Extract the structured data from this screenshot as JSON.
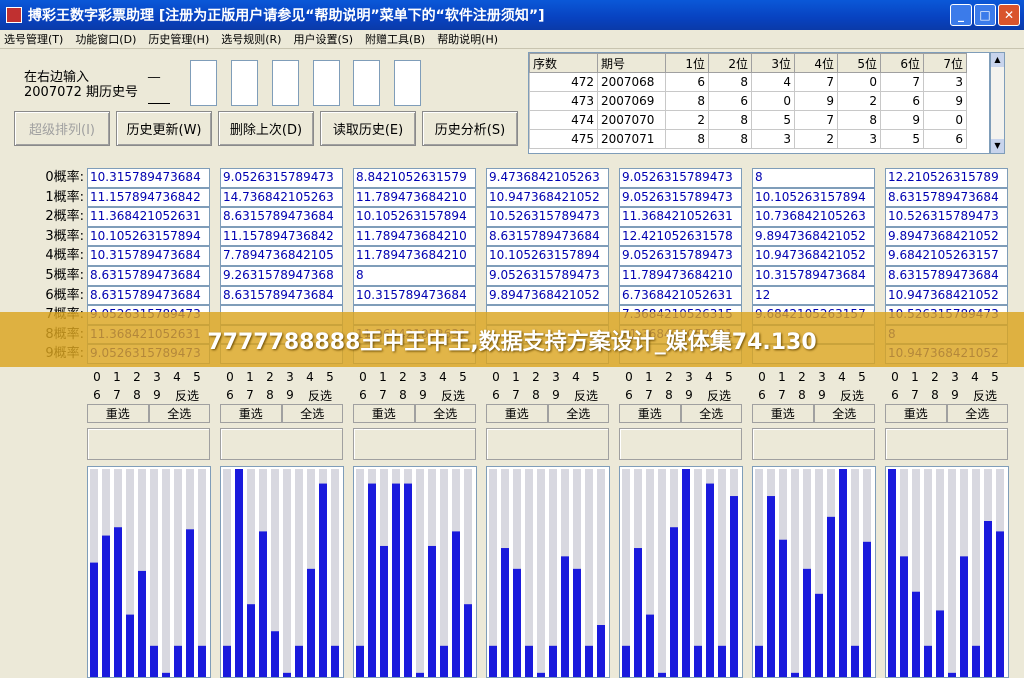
{
  "window": {
    "title": "搏彩王数字彩票助理  [注册为正版用户请参见“帮助说明”菜单下的“软件注册须知”]"
  },
  "menu": [
    "选号管理(T)",
    "功能窗口(D)",
    "历史管理(H)",
    "选号规则(R)",
    "用户设置(S)",
    "附赠工具(B)",
    "帮助说明(H)"
  ],
  "input": {
    "line1": "在右边输入",
    "line2": "2007072 期历史号",
    "placeholder": "__"
  },
  "buttons": {
    "advanced": "超级排列(I)",
    "update": "历史更新(W)",
    "delete": "删除上次(D)",
    "read": "读取历史(E)",
    "analyze": "历史分析(S)"
  },
  "history": {
    "headers": [
      "序数",
      "期号",
      "1位",
      "2位",
      "3位",
      "4位",
      "5位",
      "6位",
      "7位"
    ],
    "rows": [
      [
        "472",
        "2007068",
        "6",
        "8",
        "4",
        "7",
        "0",
        "7",
        "3"
      ],
      [
        "473",
        "2007069",
        "8",
        "6",
        "0",
        "9",
        "2",
        "6",
        "9"
      ],
      [
        "474",
        "2007070",
        "2",
        "8",
        "5",
        "7",
        "8",
        "9",
        "0"
      ],
      [
        "475",
        "2007071",
        "8",
        "8",
        "3",
        "2",
        "3",
        "5",
        "6"
      ]
    ]
  },
  "prob_labels": [
    "0概率:",
    "1概率:",
    "2概率:",
    "3概率:",
    "4概率:",
    "5概率:",
    "6概率:",
    "7概率:",
    "8概率:",
    "9概率:"
  ],
  "prob_cols": [
    [
      "10.315789473684",
      "11.157894736842",
      "11.368421052631",
      "10.105263157894",
      "10.315789473684",
      "8.6315789473684",
      "8.6315789473684",
      "9.0526315789473",
      "11.368421052631",
      "9.0526315789473"
    ],
    [
      "9.0526315789473",
      "14.736842105263",
      "8.6315789473684",
      "11.157894736842",
      "7.7894736842105",
      "9.2631578947368",
      "8.6315789473684",
      "",
      "",
      ""
    ],
    [
      "8.8421052631579",
      "11.789473684210",
      "10.105263157894",
      "11.789473684210",
      "11.789473684210",
      "8",
      "10.315789473684",
      "",
      "11.368421052631",
      ""
    ],
    [
      "9.4736842105263",
      "10.947368421052",
      "10.526315789473",
      "8.6315789473684",
      "10.105263157894",
      "9.0526315789473",
      "9.8947368421052",
      "",
      "",
      ""
    ],
    [
      "9.0526315789473",
      "9.0526315789473",
      "11.368421052631",
      "12.421052631578",
      "9.0526315789473",
      "11.789473684210",
      "6.7368421052631",
      "7.3684210526315",
      "11.368421052631",
      ""
    ],
    [
      "8",
      "10.105263157894",
      "10.736842105263",
      "9.8947368421052",
      "10.947368421052",
      "10.315789473684",
      "12",
      "9.6842105263157",
      "",
      ""
    ],
    [
      "12.210526315789",
      "8.6315789473684",
      "10.526315789473",
      "9.8947368421052",
      "9.6842105263157",
      "8.6315789473684",
      "10.947368421052",
      "10.526315789473",
      "8",
      "10.947368421052"
    ]
  ],
  "digits_row1": [
    "0",
    "1",
    "2",
    "3",
    "4",
    "5"
  ],
  "digits_row2": [
    "6",
    "7",
    "8",
    "9"
  ],
  "reverse": "反选",
  "reselect": "重选",
  "select_all": "全选",
  "banner": "7777788888王中王中王,数据支持方案设计_媒体集74.130",
  "chart_data": [
    {
      "type": "bar",
      "values": [
        0.55,
        0.68,
        0.72,
        0.3,
        0.51,
        0.15,
        0.02,
        0.15,
        0.71,
        0.15
      ]
    },
    {
      "type": "bar",
      "values": [
        0.15,
        1.0,
        0.35,
        0.7,
        0.22,
        0.02,
        0.15,
        0.52,
        0.93,
        0.15
      ]
    },
    {
      "type": "bar",
      "values": [
        0.15,
        0.93,
        0.63,
        0.93,
        0.93,
        0.02,
        0.63,
        0.15,
        0.7,
        0.35
      ]
    },
    {
      "type": "bar",
      "values": [
        0.15,
        0.62,
        0.52,
        0.15,
        0.02,
        0.15,
        0.58,
        0.52,
        0.15,
        0.25
      ]
    },
    {
      "type": "bar",
      "values": [
        0.15,
        0.62,
        0.3,
        0.02,
        0.72,
        1.0,
        0.15,
        0.93,
        0.15,
        0.87
      ]
    },
    {
      "type": "bar",
      "values": [
        0.15,
        0.87,
        0.66,
        0.02,
        0.52,
        0.4,
        0.77,
        1.0,
        0.15,
        0.65
      ]
    },
    {
      "type": "bar",
      "values": [
        1.0,
        0.58,
        0.41,
        0.15,
        0.32,
        0.02,
        0.58,
        0.15,
        0.75,
        0.7
      ]
    }
  ]
}
